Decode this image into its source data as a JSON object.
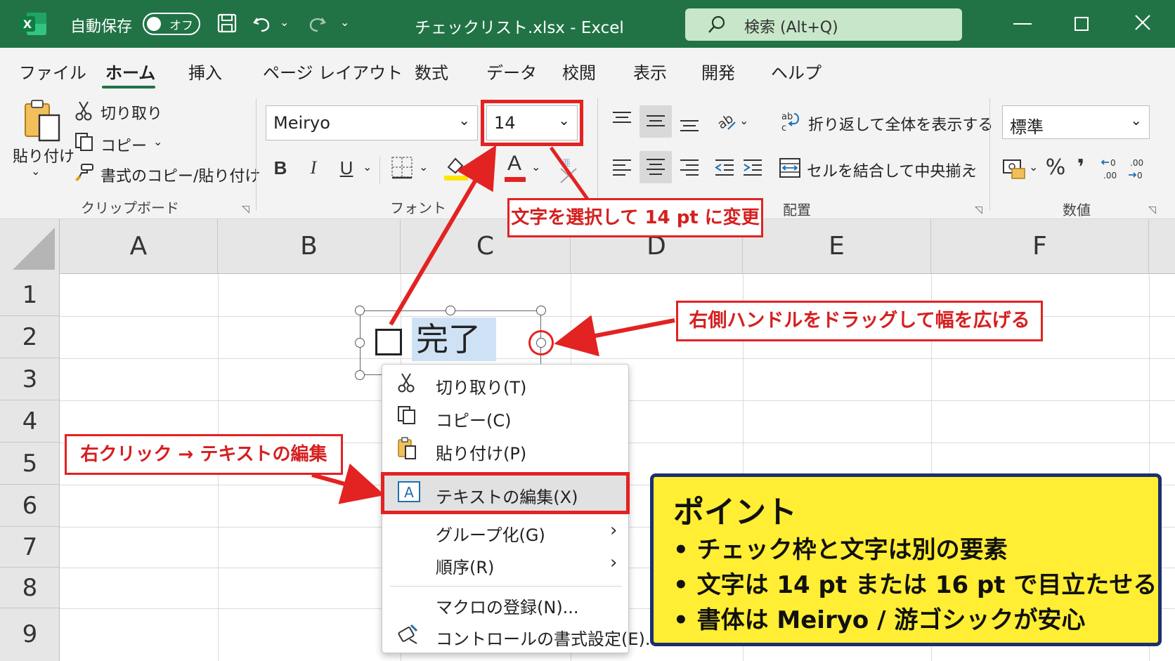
{
  "titlebar": {
    "autosave_label": "自動保存",
    "autosave_state": "オフ",
    "title": "チェックリスト.xlsx  -  Excel",
    "search_placeholder": "検索 (Alt+Q)"
  },
  "tabs": [
    {
      "label": "ファイル"
    },
    {
      "label": "ホーム",
      "active": true
    },
    {
      "label": "挿入"
    },
    {
      "label": "ページ レイアウト"
    },
    {
      "label": "数式"
    },
    {
      "label": "データ"
    },
    {
      "label": "校閲"
    },
    {
      "label": "表示"
    },
    {
      "label": "開発"
    },
    {
      "label": "ヘルプ"
    }
  ],
  "ribbon": {
    "clipboard": {
      "paste": "貼り付け",
      "cut": "切り取り",
      "copy": "コピー",
      "format_painter": "書式のコピー/貼り付け",
      "group_label": "クリップボード"
    },
    "font": {
      "font_name": "Meiryo",
      "font_size": "14",
      "bold": "B",
      "italic": "I",
      "underline": "U",
      "font_color_letter": "A",
      "group_label": "フォント"
    },
    "alignment": {
      "wrap_text": "折り返して全体を表示する",
      "merge_center": "セルを結合して中央揃え",
      "group_label": "配置"
    },
    "number": {
      "format": "標準",
      "percent": "%",
      "comma": "❜",
      "group_label": "数値"
    }
  },
  "sheet": {
    "columns": [
      "A",
      "B",
      "C",
      "D",
      "E",
      "F"
    ],
    "rows": [
      "1",
      "2",
      "3",
      "4",
      "5",
      "6",
      "7",
      "8",
      "9"
    ]
  },
  "control": {
    "label": "完了"
  },
  "context_menu": {
    "items": [
      {
        "label": "切り取り(T)",
        "icon": "scissors-icon"
      },
      {
        "label": "コピー(C)",
        "icon": "copy-icon"
      },
      {
        "label": "貼り付け(P)",
        "icon": "paste-icon"
      },
      {
        "label": "テキストの編集(X)",
        "icon": "edit-text-icon",
        "highlighted": true
      },
      {
        "label": "グループ化(G)",
        "submenu": true
      },
      {
        "label": "順序(R)",
        "submenu": true
      },
      {
        "label": "マクロの登録(N)..."
      },
      {
        "label": "コントロールの書式設定(E)...",
        "icon": "format-control-icon"
      }
    ]
  },
  "annotations": {
    "font_size_note": "文字を選択して 14 pt に変更",
    "handle_note": "右側ハンドルをドラッグして幅を広げる",
    "rightclick_note": "右クリック → テキストの編集",
    "point": {
      "heading": "ポイント",
      "lines": [
        "• チェック枠と文字は別の要素",
        "• 文字は 14 pt または 16 pt で目立たせる",
        "• 書体は Meiryo / 游ゴシックが安心"
      ]
    }
  },
  "colors": {
    "excel_green": "#217346",
    "annotation_red": "#e32222",
    "point_yellow": "#ffee33",
    "point_border": "#1e2e6e"
  }
}
